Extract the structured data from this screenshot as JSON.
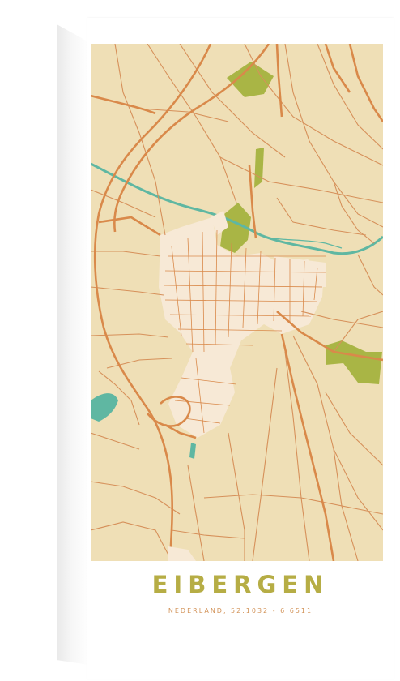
{
  "poster": {
    "city": "EIBERGEN",
    "subtitle": "NEDERLAND, 52.1032 - 6.6511"
  },
  "colors": {
    "background": "#efdfb6",
    "main_roads": "#d9894a",
    "minor_roads": "#d6905a",
    "water": "#5fb7a2",
    "green_areas": "#a9b545",
    "urban_blocks": "#f7e9d6",
    "title": "#b6ad45",
    "subtitle": "#d29257"
  }
}
